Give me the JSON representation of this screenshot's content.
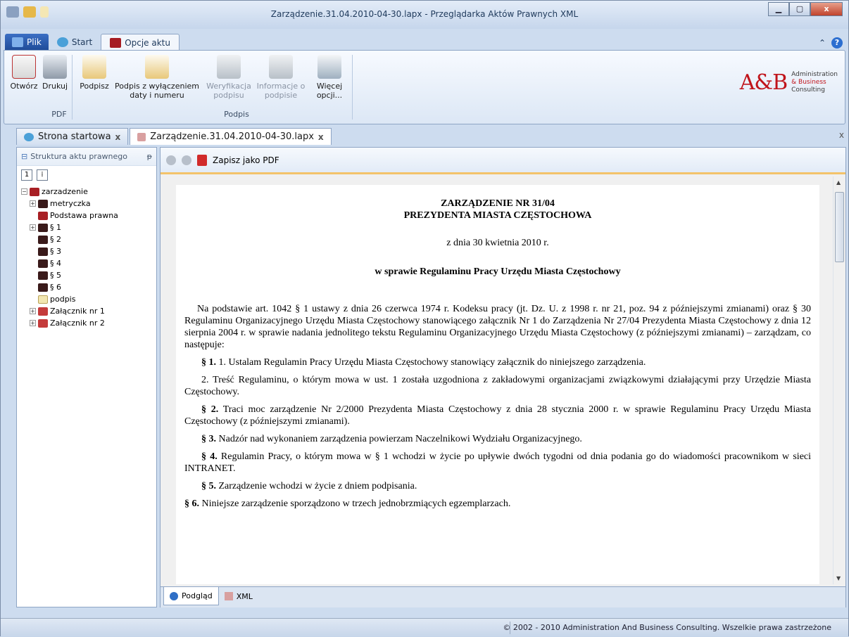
{
  "window": {
    "title": "Zarządzenie.31.04.2010-04-30.lapx - Przeglądarka Aktów Prawnych XML",
    "min": "▁",
    "max": "▢",
    "close": "x"
  },
  "ribbon_tabs": [
    {
      "label": "Plik"
    },
    {
      "label": "Start"
    },
    {
      "label": "Opcje aktu"
    }
  ],
  "ribbon": {
    "buttons": {
      "otworz": "Otwórz",
      "drukuj": "Drukuj",
      "podpisz": "Podpisz",
      "podpisz_bez": "Podpis z wyłączeniem daty i numeru",
      "weryfikacja": "Weryfikacja podpisu",
      "informacje": "Informacje o podpisie",
      "wiecej": "Więcej opcji..."
    },
    "groups": {
      "pdf": "PDF",
      "podpis": "Podpis"
    }
  },
  "logo": {
    "mark": "A&B",
    "line1": "Administration",
    "line2": "& Business",
    "line3": "Consulting"
  },
  "doc_tabs": [
    {
      "label": "Strona startowa",
      "close": "x"
    },
    {
      "label": "Zarządzenie.31.04.2010-04-30.lapx",
      "close": "x"
    }
  ],
  "close_all": "x",
  "left_panel": {
    "title": "Struktura aktu prawnego",
    "pin": "ᵽ",
    "tools": [
      "1",
      "⁞"
    ],
    "tree": [
      {
        "label": "zarzadzenie",
        "exp": "−"
      },
      {
        "label": "metryczka",
        "exp": "+"
      },
      {
        "label": "Podstawa prawna",
        "exp": ""
      },
      {
        "label": "§ 1",
        "exp": "+"
      },
      {
        "label": "§ 2",
        "exp": ""
      },
      {
        "label": "§ 3",
        "exp": ""
      },
      {
        "label": "§ 4",
        "exp": ""
      },
      {
        "label": "§ 5",
        "exp": ""
      },
      {
        "label": "§ 6",
        "exp": ""
      },
      {
        "label": "podpis",
        "exp": ""
      },
      {
        "label": "Załącznik nr 1",
        "exp": "+"
      },
      {
        "label": "Załącznik nr 2",
        "exp": "+"
      }
    ]
  },
  "viewer": {
    "save_pdf": "Zapisz jako PDF"
  },
  "document": {
    "heading1": "ZARZĄDZENIE NR 31/04",
    "heading2": "PREZYDENTA MIASTA CZĘSTOCHOWA",
    "date": "z dnia 30 kwietnia 2010 r.",
    "subject": "w sprawie Regulaminu Pracy Urzędu Miasta Częstochowy",
    "preamble": "Na podstawie art. 1042 § 1 ustawy z dnia 26 czerwca 1974 r. Kodeksu pracy (jt. Dz. U. z 1998 r. nr 21, poz. 94 z późniejszymi zmianami) oraz § 30 Regulaminu Organizacyjnego Urzędu Miasta Częstochowy stanowiącego załącznik Nr 1 do Zarządzenia Nr 27/04 Prezydenta Miasta Częstochowy z dnia 12 sierpnia 2004 r. w sprawie nadania jednolitego tekstu Regulaminu Organizacyjnego Urzędu Miasta Częstochowy (z późniejszymi zmianami) – zarządzam, co następuje:",
    "p1_num": "§ 1.",
    "p1": " 1. Ustalam Regulamin Pracy Urzędu Miasta Częstochowy stanowiący załącznik do niniejszego zarządzenia.",
    "p1b": "2. Treść Regulaminu, o którym mowa w ust. 1 została uzgodniona z zakładowymi organizacjami związkowymi działającymi przy Urzędzie Miasta Częstochowy.",
    "p2_num": "§ 2.",
    "p2": " Traci moc zarządzenie Nr 2/2000 Prezydenta Miasta Częstochowy z dnia 28 stycznia 2000 r. w sprawie Regulaminu Pracy Urzędu Miasta Częstochowy (z późniejszymi zmianami).",
    "p3_num": "§ 3.",
    "p3": " Nadzór nad wykonaniem zarządzenia powierzam Naczelnikowi Wydziału Organizacyjnego.",
    "p4_num": "§ 4.",
    "p4": " Regulamin Pracy, o którym mowa w § 1 wchodzi w życie po upływie dwóch tygodni od dnia podania go do wiadomości pracownikom w sieci INTRANET.",
    "p5_num": "§ 5.",
    "p5": " Zarządzenie wchodzi w życie z dniem podpisania.",
    "p6_num": "§ 6.",
    "p6": " Niniejsze zarządzenie sporządzono w trzech jednobrzmiących egzemplarzach."
  },
  "bottom_tabs": [
    {
      "label": "Podgląd"
    },
    {
      "label": "XML"
    }
  ],
  "status": "© 2002 - 2010 Administration And Business Consulting. Wszelkie prawa zastrzeżone"
}
